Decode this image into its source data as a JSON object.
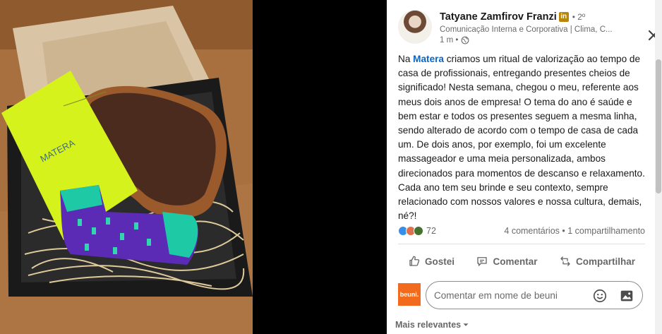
{
  "post": {
    "author": {
      "name": "Tatyane Zamfirov Franzi",
      "badge": "in",
      "degree": "• 2º",
      "headline": "Comunicação Interna e Corporativa | Clima, C...",
      "time": "1 m •"
    },
    "text_parts": {
      "prefix": "Na ",
      "mention": "Matera",
      "body": " criamos um ritual de valorização ao tempo de casa de profissionais, entregando presentes cheios de significado! Nesta semana, chegou o meu, referente aos meus dois anos de empresa! O tema do ano é saúde e bem estar e todos os presentes seguem a mesma linha, sendo alterado de acordo com o tempo de casa de cada um. De dois anos, por exemplo, foi um excelente massageador e uma meia personalizada, ambos direcionados para momentos de descanso e relaxamento. Cada ano tem seu brinde e seu contexto, sempre relacionado com nossos valores e nossa cultura, demais, né?!"
    },
    "photo": {
      "card_text": "MATERA"
    }
  },
  "social": {
    "reaction_count": "72",
    "comments_shares": "4 comentários • 1 compartilhamento",
    "reaction_icons": [
      "like-icon",
      "love-icon",
      "celebrate-icon"
    ]
  },
  "actions": {
    "like": "Gostei",
    "comment": "Comentar",
    "share": "Compartilhar"
  },
  "comment_box": {
    "avatar_text": "beuni.",
    "placeholder": "Comentar em nome de beuni"
  },
  "sort": {
    "label": "Mais relevantes"
  },
  "colors": {
    "link": "#0a66c2",
    "brand_avatar": "#f26a1b",
    "badge": "#b8860b"
  }
}
